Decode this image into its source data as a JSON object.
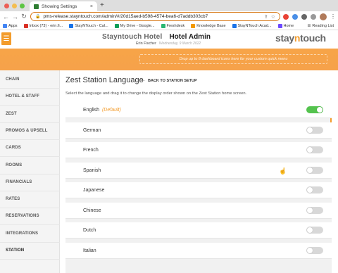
{
  "browser": {
    "tab_title": "Showing Settings",
    "url": "pms-release.stayntouch.com/admin/#/20d15aed-b598-4574-bea6-d7addb303cb7",
    "bookmarks": [
      {
        "label": "Apps",
        "color": "#4285f4"
      },
      {
        "label": "Inbox (73) - erin.fi...",
        "color": "#d93025"
      },
      {
        "label": "StayNTouch - Cal...",
        "color": "#1a73e8"
      },
      {
        "label": "My Drive - Google...",
        "color": "#0f9d58"
      },
      {
        "label": "Freshdesk",
        "color": "#2bb673"
      },
      {
        "label": "Knowledge Base",
        "color": "#f29900"
      },
      {
        "label": "StayNTouch Acad...",
        "color": "#1a73e8"
      },
      {
        "label": "Home",
        "color": "#6d4aff"
      }
    ],
    "reading_list": "Reading List"
  },
  "header": {
    "hotel_name": "Stayntouch Hotel",
    "admin_title": "Hotel Admin",
    "user_name": "Erin Fischer",
    "date": "Wednesday, 9 March 2022",
    "logo_pre": "stay",
    "logo_mid": "n",
    "logo_post": "touch",
    "quick_menu_hint": "Drop up to 8 dashboard icons here for your custom quick menu"
  },
  "sidebar": {
    "items": [
      "CHAIN",
      "HOTEL & STAFF",
      "ZEST",
      "PROMOS & UPSELL",
      "CARDS",
      "ROOMS",
      "FINANCIALS",
      "RATES",
      "RESERVATIONS",
      "INTEGRATIONS",
      "STATION"
    ],
    "active": "STATION"
  },
  "main": {
    "title": "Zest Station Language",
    "back_label": "BACK TO STATION SETUP",
    "instructions": "Select the language and drag it to change the display order shown on the Zest Station home screen.",
    "default_label": "(Default)",
    "languages": [
      {
        "name": "English",
        "enabled": true,
        "default": true
      },
      {
        "name": "German",
        "enabled": false
      },
      {
        "name": "French",
        "enabled": false
      },
      {
        "name": "Spanish",
        "enabled": false
      },
      {
        "name": "Japanese",
        "enabled": false
      },
      {
        "name": "Chinese",
        "enabled": false
      },
      {
        "name": "Dutch",
        "enabled": false
      },
      {
        "name": "Italian",
        "enabled": false
      }
    ]
  },
  "colors": {
    "accent": "#f39c2c",
    "toggle_on": "#54c34e",
    "toggle_off": "#d8d8d8"
  }
}
